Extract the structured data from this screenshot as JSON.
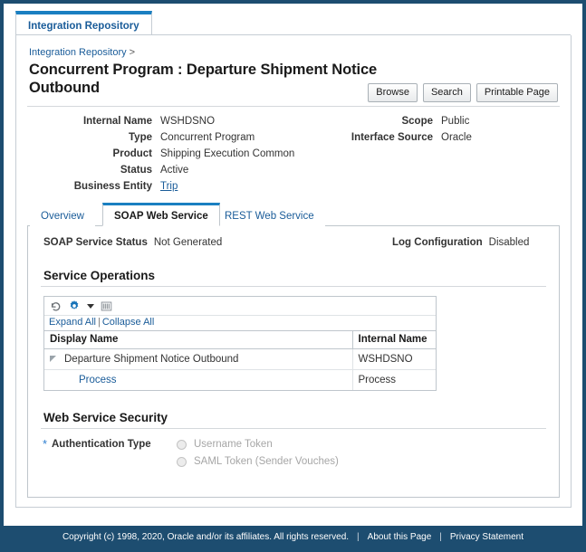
{
  "app_tab": {
    "label": "Integration Repository"
  },
  "breadcrumb": {
    "root": "Integration Repository",
    "separator": ">"
  },
  "header": {
    "title": "Concurrent Program : Departure Shipment Notice Outbound",
    "buttons": [
      {
        "label": "Browse"
      },
      {
        "label": "Search"
      },
      {
        "label": "Printable Page"
      }
    ]
  },
  "attributes": {
    "left": [
      {
        "label": "Internal Name",
        "value": "WSHDSNO",
        "link": false
      },
      {
        "label": "Type",
        "value": "Concurrent Program",
        "link": false
      },
      {
        "label": "Product",
        "value": "Shipping Execution Common",
        "link": false
      },
      {
        "label": "Status",
        "value": "Active",
        "link": false
      },
      {
        "label": "Business Entity",
        "value": "Trip",
        "link": true
      }
    ],
    "right": [
      {
        "label": "Scope",
        "value": "Public",
        "link": false
      },
      {
        "label": "Interface Source",
        "value": "Oracle",
        "link": false
      }
    ]
  },
  "tabs": [
    {
      "label": "Overview",
      "active": false
    },
    {
      "label": "SOAP Web Service",
      "active": true
    },
    {
      "label": "REST Web Service",
      "active": false
    }
  ],
  "soap_panel": {
    "service_status_label": "SOAP Service Status",
    "service_status_value": "Not Generated",
    "log_config_label": "Log Configuration",
    "log_config_value": "Disabled",
    "service_operations_heading": "Service Operations",
    "toolbar": {
      "refresh_icon": "refresh-icon",
      "gear_icon": "gear-icon",
      "dropdown_icon": "chevron-down-icon",
      "detach_icon": "detach-grid-icon",
      "expand_all": "Expand All",
      "collapse_all": "Collapse All",
      "pipe": "|"
    },
    "table": {
      "columns": [
        "Display Name",
        "Internal Name"
      ],
      "rows": [
        {
          "display_name": "Departure Shipment Notice Outbound",
          "internal_name": "WSHDSNO",
          "level": 0,
          "link": false,
          "expanded": true
        },
        {
          "display_name": "Process",
          "internal_name": "Process",
          "level": 1,
          "link": true,
          "expanded": false
        }
      ]
    },
    "security": {
      "heading": "Web Service Security",
      "required_marker": "*",
      "auth_label": "Authentication Type",
      "options": [
        {
          "label": "Username Token",
          "selected": false,
          "disabled": true
        },
        {
          "label": "SAML Token (Sender Vouches)",
          "selected": false,
          "disabled": true
        }
      ]
    }
  },
  "footer": {
    "copyright": "Copyright (c) 1998, 2020, Oracle and/or its affiliates. All rights reserved.",
    "separator": "|",
    "links": [
      {
        "label": "About this Page"
      },
      {
        "label": "Privacy Statement"
      }
    ]
  },
  "colors": {
    "frame": "#1d4d70",
    "accent_blue": "#1a7fc1",
    "link_blue": "#1a5c99",
    "required_star": "#2f7fd1",
    "footer_bg": "#1d4d70"
  }
}
